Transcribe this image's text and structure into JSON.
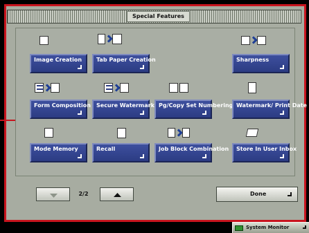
{
  "header": {
    "title": "Special Features"
  },
  "features": [
    {
      "label": "Image Creation",
      "icon": "image-creation-icon"
    },
    {
      "label": "Tab Paper Creation",
      "icon": "tab-paper-icon"
    },
    {
      "label": "Sharpness",
      "icon": "sharpness-icon"
    },
    {
      "label": "Form Composition",
      "icon": "form-composition-icon"
    },
    {
      "label": "Secure Watermark",
      "icon": "secure-watermark-icon"
    },
    {
      "label": "Pg/Copy Set Numbering",
      "icon": "numbering-icon"
    },
    {
      "label": "Watermark/ Print Date",
      "icon": "print-date-icon"
    },
    {
      "label": "Mode Memory",
      "icon": "mode-memory-icon"
    },
    {
      "label": "Recall",
      "icon": "recall-icon"
    },
    {
      "label": "Job Block Combination",
      "icon": "job-block-icon"
    },
    {
      "label": "Store In User Inbox",
      "icon": "store-inbox-icon"
    }
  ],
  "navigation": {
    "page": "2/2",
    "done_label": "Done"
  },
  "footer": {
    "system_monitor_label": "System Monitor"
  },
  "colors": {
    "accent": "#2c3c83",
    "frame": "#c8141e",
    "panel": "#a7aca1"
  }
}
